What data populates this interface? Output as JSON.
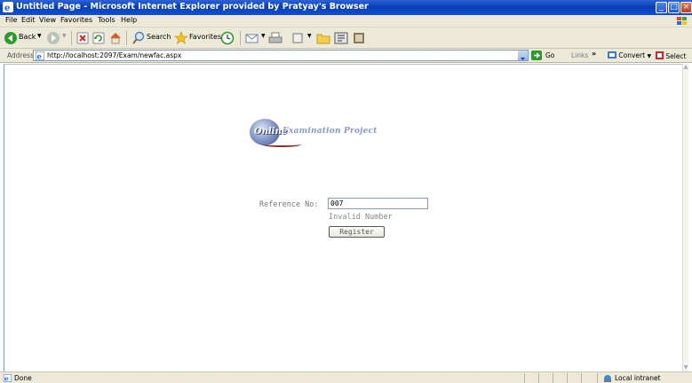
{
  "window": {
    "title": "Untitled Page - Microsoft Internet Explorer provided by Pratyay's Browser",
    "controls": [
      "_",
      "□",
      "×"
    ]
  },
  "menu": {
    "items": [
      "File",
      "Edit",
      "View",
      "Favorites",
      "Tools",
      "Help"
    ]
  },
  "toolbar": {
    "back_label": "Back",
    "search_label": "Search",
    "favorites_label": "Favorites"
  },
  "addressbar": {
    "label": "Address",
    "url": "http://localhost:2097/Exam/newfac.aspx",
    "go_label": "Go",
    "links_label": "Links",
    "more": "»",
    "convert_label": "Convert",
    "select_label": "Select"
  },
  "page": {
    "logo_online": "Online",
    "logo_title": "Examination Project",
    "reference_label": "Reference No:",
    "reference_value": "007",
    "error_message": "Invalid Number",
    "register_label": "Register"
  },
  "statusbar": {
    "status": "Done",
    "zone": "Local intranet"
  },
  "colors": {
    "titlebar": "#0a3fb8",
    "chrome": "#ece9d8",
    "go_button": "#2e9a2e"
  }
}
